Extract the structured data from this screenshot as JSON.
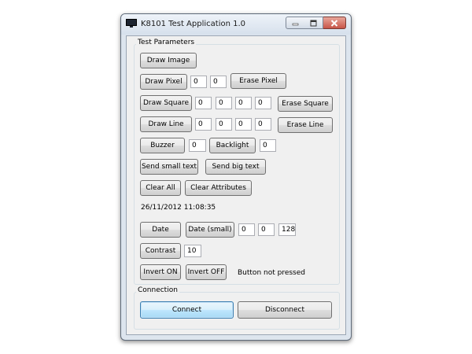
{
  "window": {
    "title": "K8101 Test Application 1.0"
  },
  "test_parameters": {
    "legend": "Test Parameters",
    "draw_image_label": "Draw Image",
    "draw_pixel": {
      "label": "Draw Pixel",
      "x": "0",
      "y": "0"
    },
    "erase_pixel_label": "Erase Pixel",
    "draw_square": {
      "label": "Draw Square",
      "x1": "0",
      "y1": "0",
      "x2": "0",
      "y2": "0"
    },
    "erase_square_label": "Erase Square",
    "draw_line": {
      "label": "Draw Line",
      "x1": "0",
      "y1": "0",
      "x2": "0",
      "y2": "0"
    },
    "erase_line_label": "Erase Line",
    "buzzer": {
      "label": "Buzzer",
      "value": "0"
    },
    "backlight": {
      "label": "Backlight",
      "value": "0"
    },
    "send_small_text_label": "Send small text",
    "send_big_text_label": "Send big text",
    "clear_all_label": "Clear All",
    "clear_attributes_label": "Clear Attributes",
    "datetime": "26/11/2012 11:08:35",
    "date_label": "Date",
    "date_small": {
      "label": "Date (small)",
      "x": "0",
      "y": "0",
      "z": "128"
    },
    "contrast": {
      "label": "Contrast",
      "value": "10"
    },
    "invert_on_label": "Invert ON",
    "invert_off_label": "Invert OFF",
    "button_status": "Button not pressed"
  },
  "connection": {
    "legend": "Connection",
    "connect_label": "Connect",
    "disconnect_label": "Disconnect"
  }
}
